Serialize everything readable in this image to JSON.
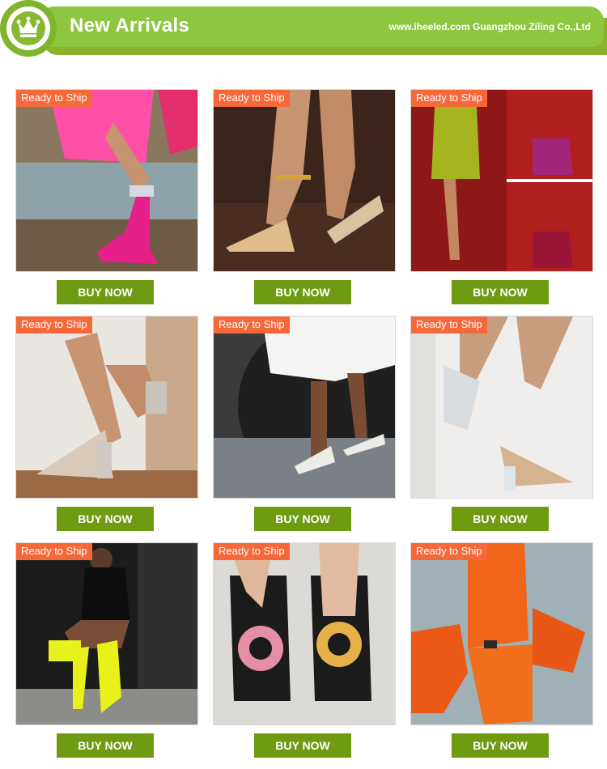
{
  "header": {
    "title": "New Arrivals",
    "company": "www.iheeled.com Guangzhou Ziling Co.,Ltd",
    "icon": "crown-icon",
    "colors": {
      "banner": "#8dc63f",
      "button": "#6e9b12",
      "tag": "#f5683a"
    }
  },
  "products": [
    {
      "tag": "Ready to Ship",
      "button": "BUY NOW"
    },
    {
      "tag": "Ready to Ship",
      "button": "BUY NOW"
    },
    {
      "tag": "Ready to Ship",
      "button": "BUY NOW"
    },
    {
      "tag": "Ready to Ship",
      "button": "BUY NOW"
    },
    {
      "tag": "Ready to Ship",
      "button": "BUY NOW"
    },
    {
      "tag": "Ready to Ship",
      "button": "BUY NOW"
    },
    {
      "tag": "Ready to Ship",
      "button": "BUY NOW"
    },
    {
      "tag": "Ready to Ship",
      "button": "BUY NOW"
    },
    {
      "tag": "Ready to Ship",
      "button": "BUY NOW"
    }
  ]
}
